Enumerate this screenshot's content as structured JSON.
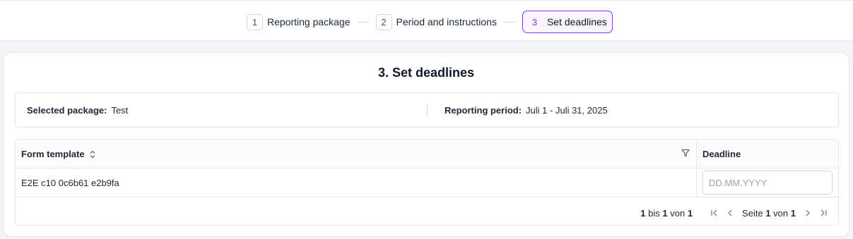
{
  "stepper": {
    "steps": [
      {
        "number": "1",
        "label": "Reporting package"
      },
      {
        "number": "2",
        "label": "Period and instructions"
      },
      {
        "number": "3",
        "label": "Set deadlines"
      }
    ],
    "active_step": 3,
    "accent_color": "#9333ea"
  },
  "card": {
    "title": "3. Set deadlines",
    "selected_package_label": "Selected package:",
    "selected_package_value": "Test",
    "reporting_period_label": "Reporting period:",
    "reporting_period_value": "Juli 1 - Juli 31, 2025"
  },
  "table": {
    "columns": [
      "Form template",
      "Deadline"
    ],
    "rows": [
      {
        "form_template": "E2E c10 0c6b61 e2b9fa",
        "deadline_value": "",
        "deadline_placeholder": "DD.MM.YYYY"
      }
    ],
    "icons": [
      "sort-icon",
      "filter-icon",
      "chevron-down-icon"
    ]
  },
  "pagination": {
    "range_from": "1",
    "range_to_word": "bis",
    "range_to": "1",
    "of_word": "von",
    "total": "1",
    "page_word": "Seite",
    "page": "1",
    "page_of_word": "von",
    "page_total": "1",
    "icons": [
      "first-page-icon",
      "prev-page-icon",
      "next-page-icon",
      "last-page-icon"
    ]
  }
}
